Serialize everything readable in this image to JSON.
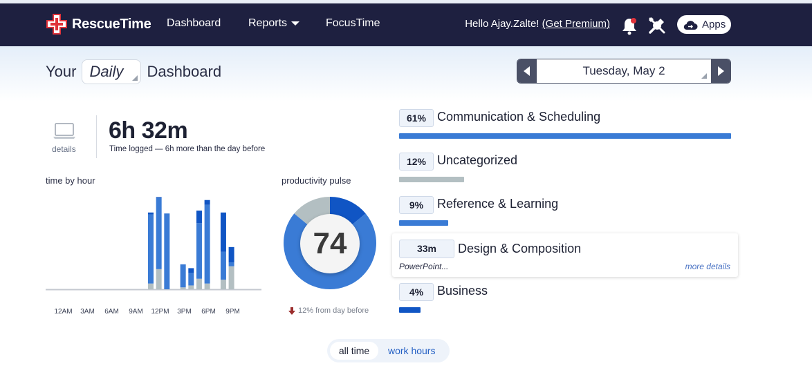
{
  "app": {
    "name": "RescueTime"
  },
  "nav": {
    "dashboard": "Dashboard",
    "reports": "Reports",
    "focustime": "FocusTime",
    "hello_prefix": "Hello Ajay.Zalte! ",
    "get_premium": "(Get Premium)",
    "apps": "Apps"
  },
  "header": {
    "your": "Your",
    "period": "Daily",
    "dashboard": "Dashboard",
    "date": "Tuesday, May 2"
  },
  "summary": {
    "details": "details",
    "total_time": "6h 32m",
    "subtitle": "Time logged — 6h more than the day before"
  },
  "time_by_hour": {
    "label": "time by hour",
    "ticks": [
      "12AM",
      "3AM",
      "6AM",
      "9AM",
      "12PM",
      "3PM",
      "6PM",
      "9PM"
    ]
  },
  "pulse": {
    "label": "productivity pulse",
    "score": "74",
    "change": "12% from day before"
  },
  "categories": [
    {
      "pct": "61%",
      "name": "Communication & Scheduling",
      "fraction": 0.61,
      "color": "#3a7bd5"
    },
    {
      "pct": "12%",
      "name": "Uncategorized",
      "fraction": 0.12,
      "color": "#b3bfc2"
    },
    {
      "pct": "9%",
      "name": "Reference & Learning",
      "fraction": 0.09,
      "color": "#3a7bd5"
    },
    {
      "pct": "33m",
      "name": "Design & Composition",
      "sub": "PowerPoint...",
      "more": "more details"
    },
    {
      "pct": "4%",
      "name": "Business",
      "fraction": 0.04,
      "color": "#1055c4"
    }
  ],
  "toggle": {
    "all_time": "all time",
    "work_hours": "work hours"
  },
  "chart_data": [
    {
      "type": "bar",
      "title": "time by hour",
      "x": [
        "12AM",
        "1AM",
        "2AM",
        "3AM",
        "4AM",
        "5AM",
        "6AM",
        "7AM",
        "8AM",
        "9AM",
        "10AM",
        "11AM",
        "12PM",
        "1PM",
        "2PM",
        "3PM",
        "4PM",
        "5PM",
        "6PM",
        "7PM",
        "8PM",
        "9PM",
        "10PM",
        "11PM"
      ],
      "series": [
        {
          "color": "#b3bfc2",
          "values": [
            0,
            0,
            0,
            0,
            0,
            0,
            0,
            0,
            0,
            0,
            0,
            0,
            0.06,
            0.21,
            0,
            0,
            0.02,
            0.04,
            0.11,
            0.06,
            0,
            0.1,
            0.24,
            0
          ]
        },
        {
          "color": "#3a7bd5",
          "values": [
            0,
            0,
            0,
            0,
            0,
            0,
            0,
            0,
            0,
            0,
            0,
            0,
            0.72,
            0.74,
            0.79,
            0,
            0.24,
            0.13,
            0.58,
            0.82,
            0,
            0.29,
            0.04,
            0
          ]
        },
        {
          "color": "#1055c4",
          "values": [
            0,
            0,
            0,
            0,
            0,
            0,
            0,
            0,
            0,
            0,
            0,
            0,
            0.02,
            0.01,
            0,
            0,
            0,
            0.05,
            0.13,
            0.05,
            0,
            0.41,
            0.16,
            0
          ]
        }
      ],
      "ylim": [
        0,
        1
      ]
    },
    {
      "type": "pie",
      "title": "productivity pulse",
      "slices": [
        {
          "value": 14,
          "color": "#1055c4"
        },
        {
          "value": 72,
          "color": "#3a7bd5"
        },
        {
          "value": 14,
          "color": "#b3bfc2"
        }
      ]
    }
  ]
}
